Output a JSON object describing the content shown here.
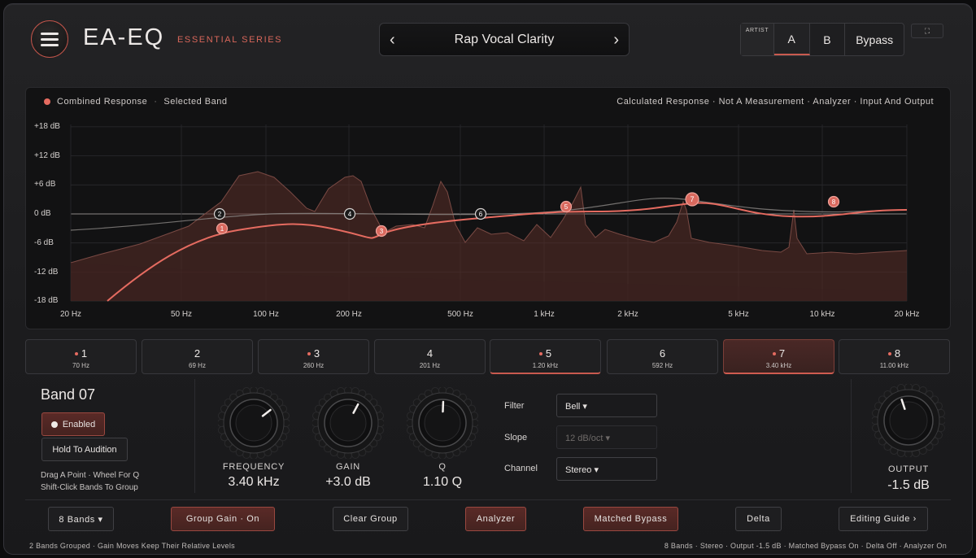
{
  "header": {
    "title": "EA-EQ",
    "series": "ESSENTIAL SERIES",
    "preset_name": "Rap Vocal Clarity",
    "prev_icon": "chevron-left-icon",
    "next_icon": "chevron-right-icon",
    "artist_label": "ARTIST",
    "a_label": "A",
    "b_label": "B",
    "bypass_label": "Bypass",
    "expand_icon": "expand-icon"
  },
  "graph": {
    "legend_combined": "Combined Response",
    "legend_selected": "Selected Band",
    "note": "Calculated Response · Not A Measurement · Analyzer · Input And Output",
    "db_labels": [
      "+18 dB",
      "+12 dB",
      "+6 dB",
      "0 dB",
      "-6 dB",
      "-12 dB",
      "-18 dB"
    ],
    "hz_labels": [
      "20 Hz",
      "50 Hz",
      "100 Hz",
      "200 Hz",
      "500 Hz",
      "1 kHz",
      "2 kHz",
      "5 kHz",
      "10 kHz",
      "20 kHz"
    ],
    "colors": {
      "curve": "#e56b60",
      "fill": "#5a2e28",
      "grid": "#2a2a2e"
    }
  },
  "bands": [
    {
      "num": "1",
      "freq": "70 Hz",
      "active": true
    },
    {
      "num": "2",
      "freq": "69 Hz",
      "active": false
    },
    {
      "num": "3",
      "freq": "260 Hz",
      "active": true
    },
    {
      "num": "4",
      "freq": "201 Hz",
      "active": false
    },
    {
      "num": "5",
      "freq": "1.20 kHz",
      "active": true
    },
    {
      "num": "6",
      "freq": "592 Hz",
      "active": false
    },
    {
      "num": "7",
      "freq": "3.40 kHz",
      "active": true
    },
    {
      "num": "8",
      "freq": "11.00 kHz",
      "active": true
    }
  ],
  "panel": {
    "title": "Band 07",
    "enabled_label": "Enabled",
    "audition_label": "Hold To Audition",
    "hint1": "Drag A Point · Wheel For Q",
    "hint2": "Shift-Click Bands To Group",
    "freq_label": "FREQUENCY",
    "freq_value": "3.40 kHz",
    "gain_label": "GAIN",
    "gain_value": "+3.0 dB",
    "q_label": "Q",
    "q_value": "1.10 Q",
    "filter_label": "Filter",
    "filter_value": "Bell ▾",
    "slope_label": "Slope",
    "slope_value": "12 dB/oct ▾",
    "channel_label": "Channel",
    "channel_value": "Stereo ▾",
    "output_label": "OUTPUT",
    "output_value": "-1.5 dB"
  },
  "footer": {
    "bands_btn": "8 Bands ▾",
    "group_gain_btn": "Group Gain · On",
    "clear_group_btn": "Clear Group",
    "analyzer_btn": "Analyzer",
    "matched_bypass_btn": "Matched Bypass",
    "delta_btn": "Delta",
    "guide_btn": "Editing Guide ›",
    "status_left": "2 Bands Grouped · Gain Moves Keep Their Relative Levels",
    "status_right": "8 Bands · Stereo · Output -1.5 dB · Matched Bypass On · Delta Off · Analyzer On"
  }
}
